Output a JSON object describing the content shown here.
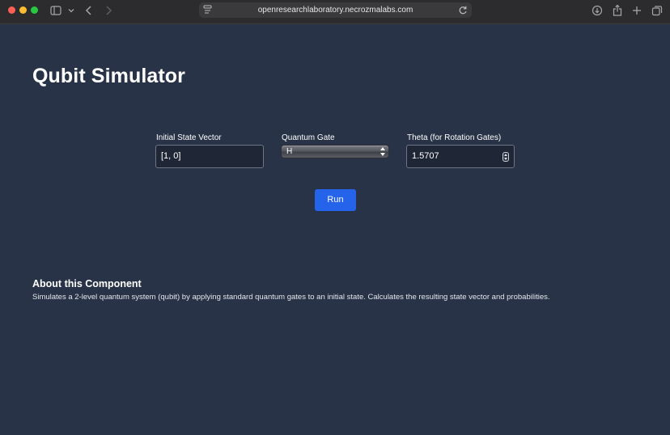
{
  "browser": {
    "url": "openresearchlaboratory.necrozmalabs.com",
    "icons": [
      "sidebar-icon",
      "chevron-down-icon",
      "back-icon",
      "forward-icon",
      "site-icon",
      "reload-icon",
      "download-icon",
      "share-icon",
      "new-tab-icon",
      "tab-overview-icon"
    ]
  },
  "page": {
    "title": "Qubit Simulator",
    "fields": {
      "state_label": "Initial State Vector",
      "state_value": "[1, 0]",
      "gate_label": "Quantum Gate",
      "gate_value": "H",
      "theta_label": "Theta (for Rotation Gates)",
      "theta_value": "1.5707"
    },
    "run_label": "Run",
    "about": {
      "heading": "About this Component",
      "text": "Simulates a 2-level quantum system (qubit) by applying standard quantum gates to an initial state. Calculates the resulting state vector and probabilities."
    }
  },
  "colors": {
    "background": "#283347",
    "accent": "#2563eb",
    "input_bg": "#1f2736"
  }
}
